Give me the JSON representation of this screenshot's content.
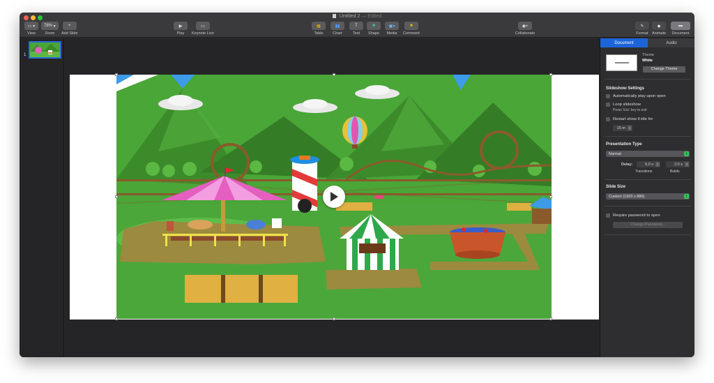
{
  "window": {
    "title": "Untitled 2",
    "status": "— Edited",
    "traffic_colors": [
      "#fe5f57",
      "#febc2e",
      "#28c840"
    ]
  },
  "toolbar": {
    "view_label": "View",
    "zoom_value": "78%",
    "zoom_label": "Zoom",
    "add_slide_label": "Add Slide",
    "play_label": "Play",
    "keynote_live_label": "Keynote Live",
    "table_label": "Table",
    "chart_label": "Chart",
    "text_label": "Text",
    "shape_label": "Shape",
    "media_label": "Media",
    "comment_label": "Comment",
    "collaborate_label": "Collaborate",
    "format_label": "Format",
    "animate_label": "Animate",
    "document_label": "Document"
  },
  "navigator": {
    "slide_number": "1"
  },
  "inspector": {
    "tabs": [
      "Document",
      "Audio"
    ],
    "theme_label": "Theme",
    "theme_name": "White",
    "change_theme_button": "Change Theme",
    "slideshow_settings_title": "Slideshow Settings",
    "auto_play_label": "Automatically play upon open",
    "loop_label": "Loop slideshow",
    "loop_sub": "Press 'Esc' key to exit",
    "restart_label": "Restart show if idle for",
    "idle_value": "15 m",
    "presentation_type_title": "Presentation Type",
    "presentation_type_value": "Normal",
    "delay_label": "Delay:",
    "transitions_value": "5.0 s",
    "transitions_label": "Transitions",
    "builds_value": "2.0 s",
    "builds_label": "Builds",
    "slide_size_title": "Slide Size",
    "slide_size_value": "Custom (1920 x 886)",
    "require_password_label": "Require password to open",
    "change_password_button": "Change Password..."
  },
  "colors": {
    "accent": "#1d64d8",
    "grass": "#49a637",
    "mountain": "#3c8b2b",
    "sky_blue": "#3d9be9"
  }
}
